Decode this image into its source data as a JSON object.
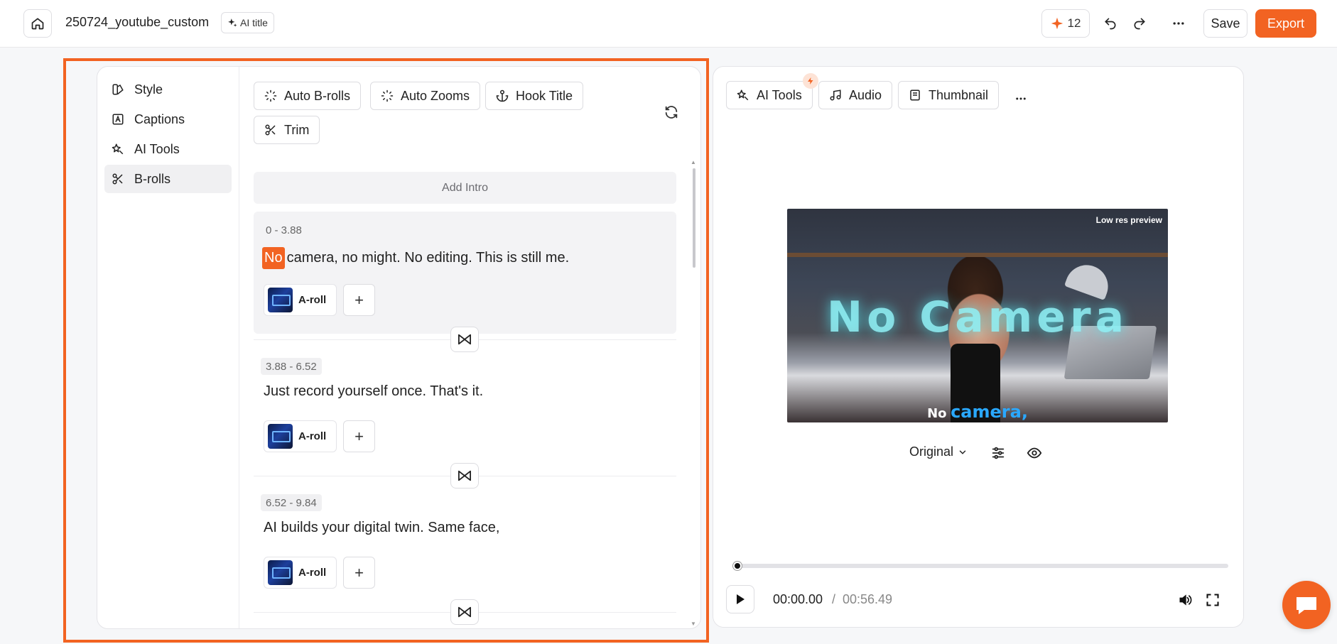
{
  "header": {
    "project_title": "250724_youtube_custom",
    "ai_title_label": "AI title",
    "credits": "12",
    "save_label": "Save",
    "export_label": "Export",
    "accent_color": "#f26322"
  },
  "sidebar": {
    "items": [
      {
        "label": "Style",
        "icon": "palette-icon"
      },
      {
        "label": "Captions",
        "icon": "captions-icon"
      },
      {
        "label": "AI Tools",
        "icon": "ai-wand-icon"
      },
      {
        "label": "B-rolls",
        "icon": "scissors-icon",
        "active": true
      }
    ]
  },
  "toolbar": {
    "auto_brolls": "Auto B-rolls",
    "auto_zooms": "Auto Zooms",
    "hook_title": "Hook Title",
    "trim": "Trim"
  },
  "script": {
    "add_intro": "Add Intro",
    "segments": [
      {
        "time": "0 - 3.88",
        "highlight_word": "No",
        "text": "camera, no might. No editing. This is still me.",
        "aroll_label": "A-roll",
        "active": true
      },
      {
        "time": "3.88 - 6.52",
        "text": "Just record yourself once. That's it.",
        "aroll_label": "A-roll"
      },
      {
        "time": "6.52 - 9.84",
        "text": "AI builds your digital twin. Same face,",
        "aroll_label": "A-roll"
      }
    ]
  },
  "preview": {
    "tabs": {
      "ai_tools": "AI Tools",
      "audio": "Audio",
      "thumbnail": "Thumbnail"
    },
    "video": {
      "badge": "Low res preview",
      "overlay_title": "No Camera",
      "subtitle_word1": "No",
      "subtitle_word2": "camera,"
    },
    "ratio": "Original",
    "progress_fraction": 0.0,
    "time_current": "00:00.00",
    "time_separator": "/",
    "time_total": "00:56.49"
  }
}
